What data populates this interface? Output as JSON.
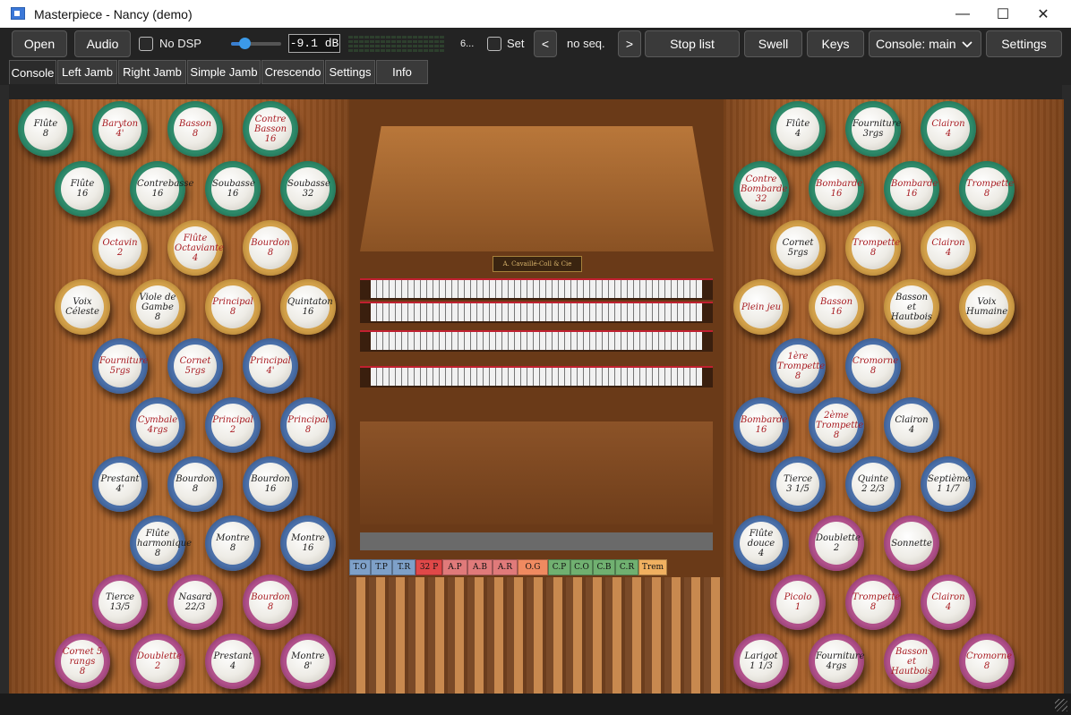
{
  "window": {
    "title": "Masterpiece - Nancy (demo)",
    "minimize_glyph": "—",
    "maximize_glyph": "☐",
    "close_glyph": "✕"
  },
  "toolbar": {
    "open": "Open",
    "audio": "Audio",
    "no_dsp": "No DSP",
    "gain": "-9.1 dB",
    "volume_level": 0.55,
    "meter_label": "6...",
    "set": "Set",
    "prev": "<",
    "no_seq": "no seq.",
    "next": ">",
    "stop_list": "Stop list",
    "swell": "Swell",
    "keys": "Keys",
    "console_select": "Console: main",
    "settings": "Settings"
  },
  "tabs": [
    "Console",
    "Left Jamb",
    "Right Jamb",
    "Simple Jamb",
    "Crescendo",
    "Settings",
    "Info"
  ],
  "active_tab": 0,
  "ring_colors": {
    "green": "#2e8a6a",
    "gold": "#d2a04a",
    "blue": "#4a6fa8",
    "purple": "#b0508a"
  },
  "left_stops": [
    {
      "name": "Flûte",
      "pitch": "8",
      "ring": "green",
      "text": "black"
    },
    {
      "name": "Baryton",
      "pitch": "4'",
      "ring": "green",
      "text": "red"
    },
    {
      "name": "Basson",
      "pitch": "8",
      "ring": "green",
      "text": "red"
    },
    {
      "name": "Contre Basson",
      "pitch": "16",
      "ring": "green",
      "text": "red"
    },
    {
      "name": "Flûte",
      "pitch": "16",
      "ring": "green",
      "text": "black"
    },
    {
      "name": "Contrebasse",
      "pitch": "16",
      "ring": "green",
      "text": "black"
    },
    {
      "name": "Soubasse",
      "pitch": "16",
      "ring": "green",
      "text": "black"
    },
    {
      "name": "Soubasse",
      "pitch": "32",
      "ring": "green",
      "text": "black"
    },
    {
      "name": "Octavin",
      "pitch": "2",
      "ring": "gold",
      "text": "red"
    },
    {
      "name": "Flûte Octaviante",
      "pitch": "4",
      "ring": "gold",
      "text": "red"
    },
    {
      "name": "Bourdon",
      "pitch": "8",
      "ring": "gold",
      "text": "red"
    },
    {
      "name": "Voix Céleste",
      "pitch": "",
      "ring": "gold",
      "text": "black"
    },
    {
      "name": "Viole de Gambe",
      "pitch": "8",
      "ring": "gold",
      "text": "black"
    },
    {
      "name": "Principal",
      "pitch": "8",
      "ring": "gold",
      "text": "red"
    },
    {
      "name": "Quintaton",
      "pitch": "16",
      "ring": "gold",
      "text": "black"
    },
    {
      "name": "Fourniture",
      "pitch": "5rgs",
      "ring": "blue",
      "text": "red"
    },
    {
      "name": "Cornet",
      "pitch": "5rgs",
      "ring": "blue",
      "text": "red"
    },
    {
      "name": "Principal",
      "pitch": "4'",
      "ring": "blue",
      "text": "red"
    },
    {
      "name": "Cymbale",
      "pitch": "4rgs",
      "ring": "blue",
      "text": "red"
    },
    {
      "name": "Principal",
      "pitch": "2",
      "ring": "blue",
      "text": "red"
    },
    {
      "name": "Principal",
      "pitch": "8",
      "ring": "blue",
      "text": "red"
    },
    {
      "name": "Prestant",
      "pitch": "4'",
      "ring": "blue",
      "text": "black"
    },
    {
      "name": "Bourdon",
      "pitch": "8",
      "ring": "blue",
      "text": "black"
    },
    {
      "name": "Bourdon",
      "pitch": "16",
      "ring": "blue",
      "text": "black"
    },
    {
      "name": "Flûte harmonique",
      "pitch": "8",
      "ring": "blue",
      "text": "black"
    },
    {
      "name": "Montre",
      "pitch": "8",
      "ring": "blue",
      "text": "black"
    },
    {
      "name": "Montre",
      "pitch": "16",
      "ring": "blue",
      "text": "black"
    },
    {
      "name": "Tierce",
      "pitch": "13/5",
      "ring": "purple",
      "text": "black"
    },
    {
      "name": "Nasard",
      "pitch": "22/3",
      "ring": "purple",
      "text": "black"
    },
    {
      "name": "Bourdon",
      "pitch": "8",
      "ring": "purple",
      "text": "red"
    },
    {
      "name": "Cornet 5 rangs",
      "pitch": "8",
      "ring": "purple",
      "text": "red"
    },
    {
      "name": "Doublette",
      "pitch": "2",
      "ring": "purple",
      "text": "red"
    },
    {
      "name": "Prestant",
      "pitch": "4",
      "ring": "purple",
      "text": "black"
    },
    {
      "name": "Montre",
      "pitch": "8'",
      "ring": "purple",
      "text": "black"
    }
  ],
  "right_stops": [
    {
      "name": "Flûte",
      "pitch": "4",
      "ring": "green",
      "text": "black"
    },
    {
      "name": "Fourniture",
      "pitch": "3rgs",
      "ring": "green",
      "text": "black"
    },
    {
      "name": "Clairon",
      "pitch": "4",
      "ring": "green",
      "text": "red"
    },
    {
      "name": "Contre Bombarde",
      "pitch": "32",
      "ring": "green",
      "text": "red"
    },
    {
      "name": "Bombarde",
      "pitch": "16",
      "ring": "green",
      "text": "red"
    },
    {
      "name": "Bombarde",
      "pitch": "16",
      "ring": "green",
      "text": "red"
    },
    {
      "name": "Trompette",
      "pitch": "8",
      "ring": "green",
      "text": "red"
    },
    {
      "name": "Cornet",
      "pitch": "5rgs",
      "ring": "gold",
      "text": "black"
    },
    {
      "name": "Trompette",
      "pitch": "8",
      "ring": "gold",
      "text": "red"
    },
    {
      "name": "Clairon",
      "pitch": "4",
      "ring": "gold",
      "text": "red"
    },
    {
      "name": "Plein jeu",
      "pitch": "",
      "ring": "gold",
      "text": "red"
    },
    {
      "name": "Basson",
      "pitch": "16",
      "ring": "gold",
      "text": "red"
    },
    {
      "name": "Basson et Hautbois",
      "pitch": "",
      "ring": "gold",
      "text": "black"
    },
    {
      "name": "Voix Humaine",
      "pitch": "",
      "ring": "gold",
      "text": "black"
    },
    {
      "name": "1ère Trompette",
      "pitch": "8",
      "ring": "blue",
      "text": "red"
    },
    {
      "name": "Cromorne",
      "pitch": "8",
      "ring": "blue",
      "text": "red"
    },
    {
      "name": "Bombarde",
      "pitch": "16",
      "ring": "blue",
      "text": "red"
    },
    {
      "name": "2ème Trompette",
      "pitch": "8",
      "ring": "blue",
      "text": "red"
    },
    {
      "name": "Clairon",
      "pitch": "4",
      "ring": "blue",
      "text": "black"
    },
    {
      "name": "Tierce",
      "pitch": "3 1/5",
      "ring": "blue",
      "text": "black"
    },
    {
      "name": "Quinte",
      "pitch": "2 2/3",
      "ring": "blue",
      "text": "black"
    },
    {
      "name": "Septième",
      "pitch": "1 1/7",
      "ring": "blue",
      "text": "black"
    },
    {
      "name": "Flûte douce",
      "pitch": "4",
      "ring": "blue",
      "text": "black"
    },
    {
      "name": "Doublette",
      "pitch": "2",
      "ring": "purple",
      "text": "black"
    },
    {
      "name": "Sonnette",
      "pitch": "",
      "ring": "purple",
      "text": "black"
    },
    {
      "name": "Picolo",
      "pitch": "1",
      "ring": "purple",
      "text": "red"
    },
    {
      "name": "Trompette",
      "pitch": "8",
      "ring": "purple",
      "text": "red"
    },
    {
      "name": "Clairon",
      "pitch": "4",
      "ring": "purple",
      "text": "red"
    },
    {
      "name": "Larigot",
      "pitch": "1 1/3",
      "ring": "purple",
      "text": "black"
    },
    {
      "name": "Fourniture",
      "pitch": "4rgs",
      "ring": "purple",
      "text": "black"
    },
    {
      "name": "Basson et Hautbois",
      "pitch": "",
      "ring": "purple",
      "text": "red"
    },
    {
      "name": "Cromorne",
      "pitch": "8",
      "ring": "purple",
      "text": "red"
    }
  ],
  "nameplate": "A. Cavaillé-Coll & Cie",
  "pedal_labels": [
    {
      "text": "T.O",
      "color": "#7ea0c8"
    },
    {
      "text": "T.P",
      "color": "#7ea0c8"
    },
    {
      "text": "T.R",
      "color": "#7ea0c8"
    },
    {
      "text": "32 P",
      "color": "#e04848"
    },
    {
      "text": "A.P",
      "color": "#e07a7a"
    },
    {
      "text": "A.B",
      "color": "#e07a7a"
    },
    {
      "text": "A.R",
      "color": "#e07a7a"
    },
    {
      "text": "O.G",
      "color": "#f08a60"
    },
    {
      "text": "C.P",
      "color": "#70b070"
    },
    {
      "text": "C.O",
      "color": "#70b070"
    },
    {
      "text": "C.B",
      "color": "#70b070"
    },
    {
      "text": "C.R",
      "color": "#70b070"
    },
    {
      "text": "Trem",
      "color": "#f0b060"
    }
  ]
}
